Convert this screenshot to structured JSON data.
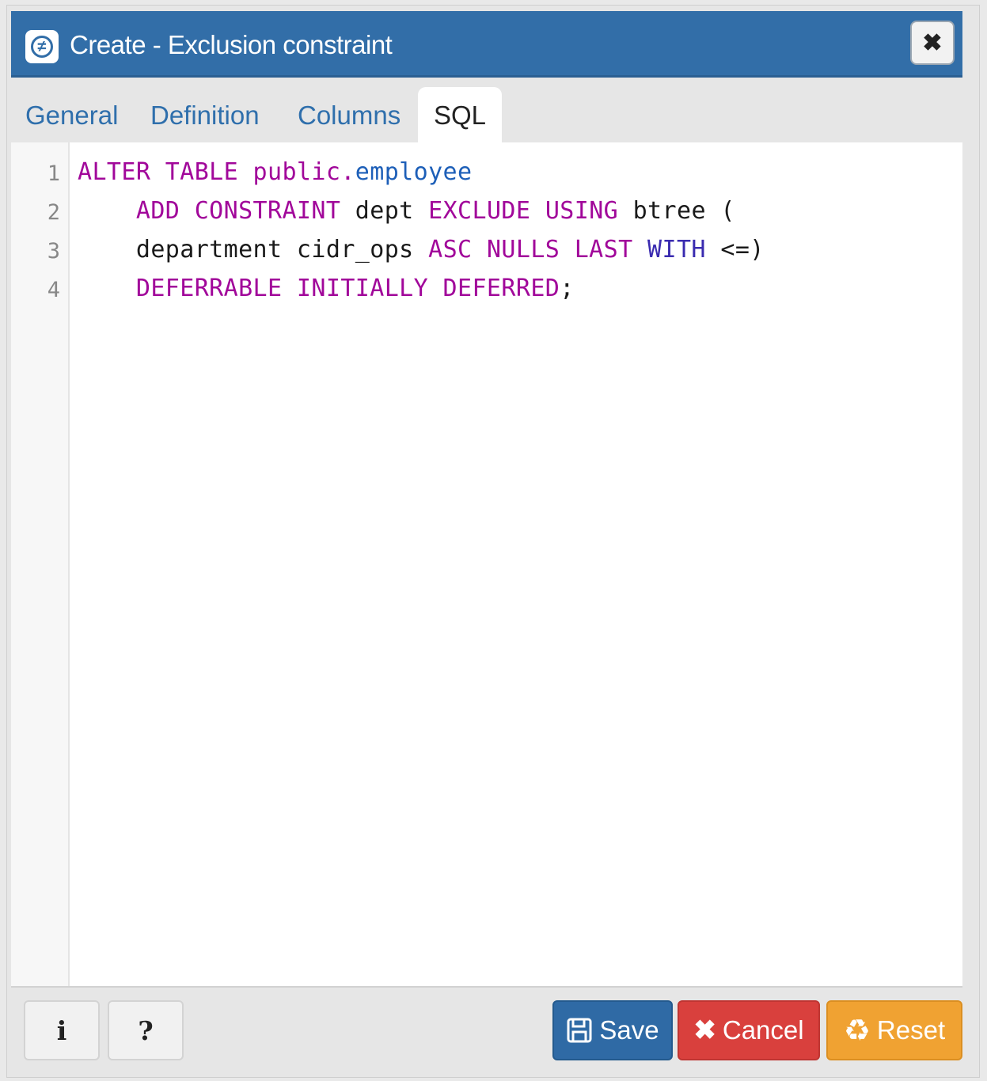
{
  "dialog": {
    "title": "Create - Exclusion constraint",
    "icon": "not-equal-icon",
    "close_icon": "close-icon"
  },
  "tabs": [
    {
      "label": "General"
    },
    {
      "label": "Definition"
    },
    {
      "label": "Columns"
    },
    {
      "label": "SQL",
      "active": true
    }
  ],
  "editor": {
    "line_numbers": [
      "1",
      "2",
      "3",
      "4"
    ],
    "lines": [
      "ALTER TABLE public.employee",
      "    ADD CONSTRAINT dept EXCLUDE USING btree (",
      "    department cidr_ops ASC NULLS LAST WITH <=)",
      "    DEFERRABLE INITIALLY DEFERRED;"
    ],
    "tokens": {
      "l1_kw": "ALTER TABLE",
      "l1_schema": "public.",
      "l1_table": "employee",
      "l2_kw1": "ADD CONSTRAINT",
      "l2_name": "dept",
      "l2_kw2": "EXCLUDE USING",
      "l2_rest": "btree (",
      "l3_col": "department cidr_ops",
      "l3_kw": "ASC NULLS LAST",
      "l3_with": "WITH",
      "l3_op": "<=)",
      "l4_kw": "DEFERRABLE INITIALLY DEFERRED",
      "l4_end": ";"
    }
  },
  "footer": {
    "info_label": "i",
    "help_label": "?",
    "save_label": "Save",
    "cancel_label": "Cancel",
    "reset_label": "Reset"
  },
  "colors": {
    "titlebar": "#326ea8",
    "tab_link": "#2f6fac",
    "keyword": "#a1079a",
    "identifier": "#1d5fb8",
    "save": "#2f6aa5",
    "cancel": "#d9403d",
    "reset": "#f0a232"
  }
}
